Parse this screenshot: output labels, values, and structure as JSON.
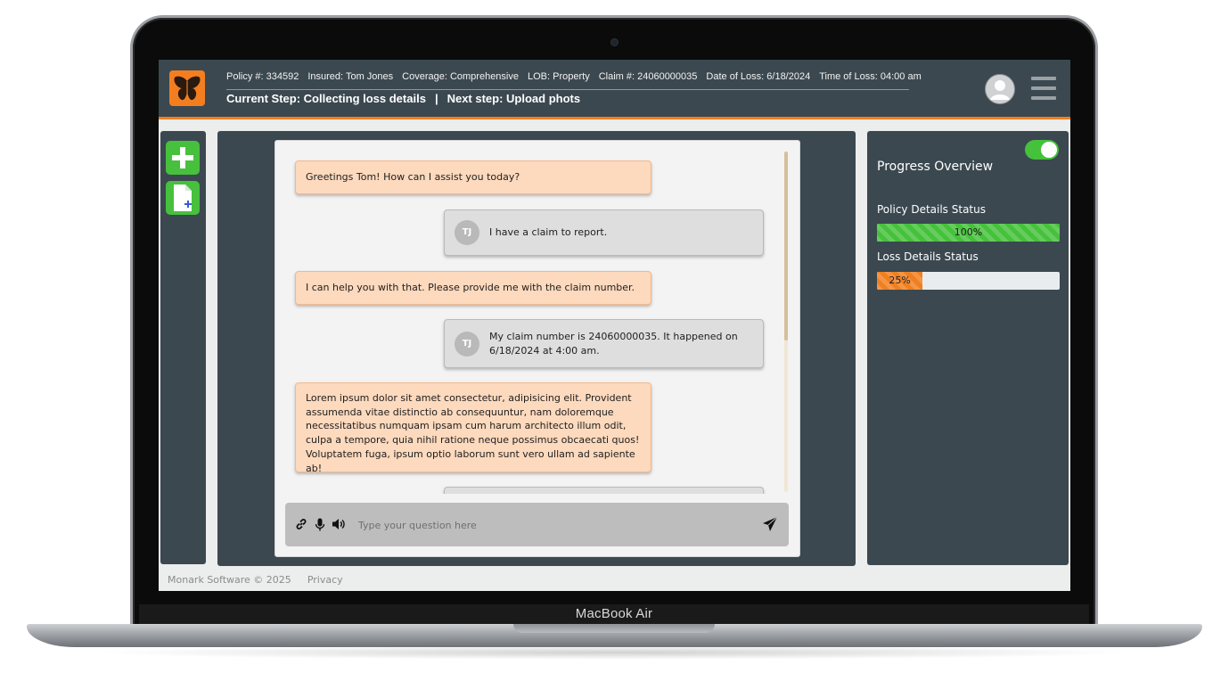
{
  "device": {
    "label": "MacBook Air"
  },
  "header": {
    "policy": "Policy #: 334592",
    "insured": "Insured: Tom Jones",
    "coverage": "Coverage: Comprehensive",
    "lob": "LOB: Property",
    "claim": "Claim #: 24060000035",
    "date_of_loss": "Date of Loss: 6/18/2024",
    "time_of_loss": "Time of Loss: 04:00 am",
    "current_step": "Current Step: Collecting loss details",
    "separator": "|",
    "next_step": "Next step: Upload phots"
  },
  "sidebar": {
    "icons": [
      "plus-icon",
      "new-document-icon"
    ]
  },
  "chat": {
    "messages": [
      {
        "from": "bot",
        "text": "Greetings Tom! How can I assist you today?"
      },
      {
        "from": "user",
        "initials": "TJ",
        "text": "I have a claim to report."
      },
      {
        "from": "bot",
        "text": "I can help you with that. Please provide me with the claim number."
      },
      {
        "from": "user",
        "initials": "TJ",
        "text": "My claim number is 24060000035. It happened on 6/18/2024 at 4:00 am."
      },
      {
        "from": "bot",
        "text": "Lorem ipsum dolor sit amet consectetur, adipisicing elit. Provident assumenda vitae distinctio ab consequuntur, nam doloremque necessitatibus numquam ipsam cum harum architecto illum odit, culpa a tempore, quia nihil ratione neque possimus obcaecati quos! Voluptatem fuga, ipsum optio laborum sunt vero ullam ad sapiente ab!"
      }
    ],
    "input": {
      "placeholder": "Type your question here",
      "value": ""
    },
    "tools": [
      "link-icon",
      "microphone-icon",
      "speaker-icon"
    ],
    "send_icon": "send-icon"
  },
  "progress": {
    "toggle_on": true,
    "title": "Progress Overview",
    "items": [
      {
        "label": "Policy Details Status",
        "value": 100,
        "display": "100%",
        "color": "#45c13b"
      },
      {
        "label": "Loss Details Status",
        "value": 25,
        "display": "25%",
        "color": "#f07f1f"
      }
    ]
  },
  "footer": {
    "copyright": "Monark Software © 2025",
    "privacy": "Privacy"
  },
  "colors": {
    "panel": "#3b4850",
    "accent": "#f07f1f",
    "green": "#45c13b",
    "bot_bubble": "#fdd9bd",
    "user_bubble": "#dedede"
  }
}
